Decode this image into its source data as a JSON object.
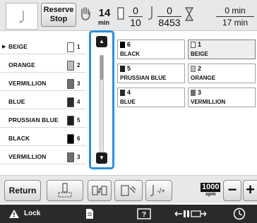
{
  "header": {
    "reserve_stop_line1": "Reserve",
    "reserve_stop_line2": "Stop",
    "time_value": "14",
    "time_unit": "min",
    "color_progress": {
      "numerator": "0",
      "denominator": "10"
    },
    "stitch_progress": {
      "numerator": "0",
      "denominator": "8453"
    },
    "total_time": {
      "numerator": "0 min",
      "denominator": "17 min"
    }
  },
  "thread_list": {
    "current_marker": "▶",
    "rows": [
      {
        "name": "BEIGE",
        "num": "1",
        "color": "#ffffff"
      },
      {
        "name": "ORANGE",
        "num": "2",
        "color": "#bdbdbd"
      },
      {
        "name": "VERMILLION",
        "num": "3",
        "color": "#6e6e6e"
      },
      {
        "name": "BLUE",
        "num": "4",
        "color": "#2b2b2b"
      },
      {
        "name": "PRUSSIAN BLUE",
        "num": "5",
        "color": "#1e1e1e"
      },
      {
        "name": "BLACK",
        "num": "6",
        "color": "#000000"
      },
      {
        "name": "VERMILLION",
        "num": "3",
        "color": "#6e6e6e"
      }
    ]
  },
  "scroll": {
    "up_glyph": "▲",
    "down_glyph": "▼",
    "position": 0.0
  },
  "grid": {
    "cells": [
      {
        "num": "6",
        "name": "BLACK",
        "color": "#000000",
        "selected": false
      },
      {
        "num": "1",
        "name": "BEIGE",
        "color": "#ffffff",
        "selected": true
      },
      {
        "num": "5",
        "name": "PRUSSIAN BLUE",
        "color": "#1e1e1e",
        "selected": false
      },
      {
        "num": "2",
        "name": "ORANGE",
        "color": "#bdbdbd",
        "selected": false
      },
      {
        "num": "4",
        "name": "BLUE",
        "color": "#2b2b2b",
        "selected": false
      },
      {
        "num": "3",
        "name": "VERMILLION",
        "color": "#6e6e6e",
        "selected": false
      }
    ]
  },
  "toolbar": {
    "return_label": "Return",
    "speed_value": "1000",
    "speed_unit": "spm",
    "minus_label": "−",
    "plus_label": "+"
  },
  "footer": {
    "lock_label": "Lock"
  },
  "colors": {
    "accent": "#2b8fe0",
    "footer_bg": "#2a2a2a"
  }
}
